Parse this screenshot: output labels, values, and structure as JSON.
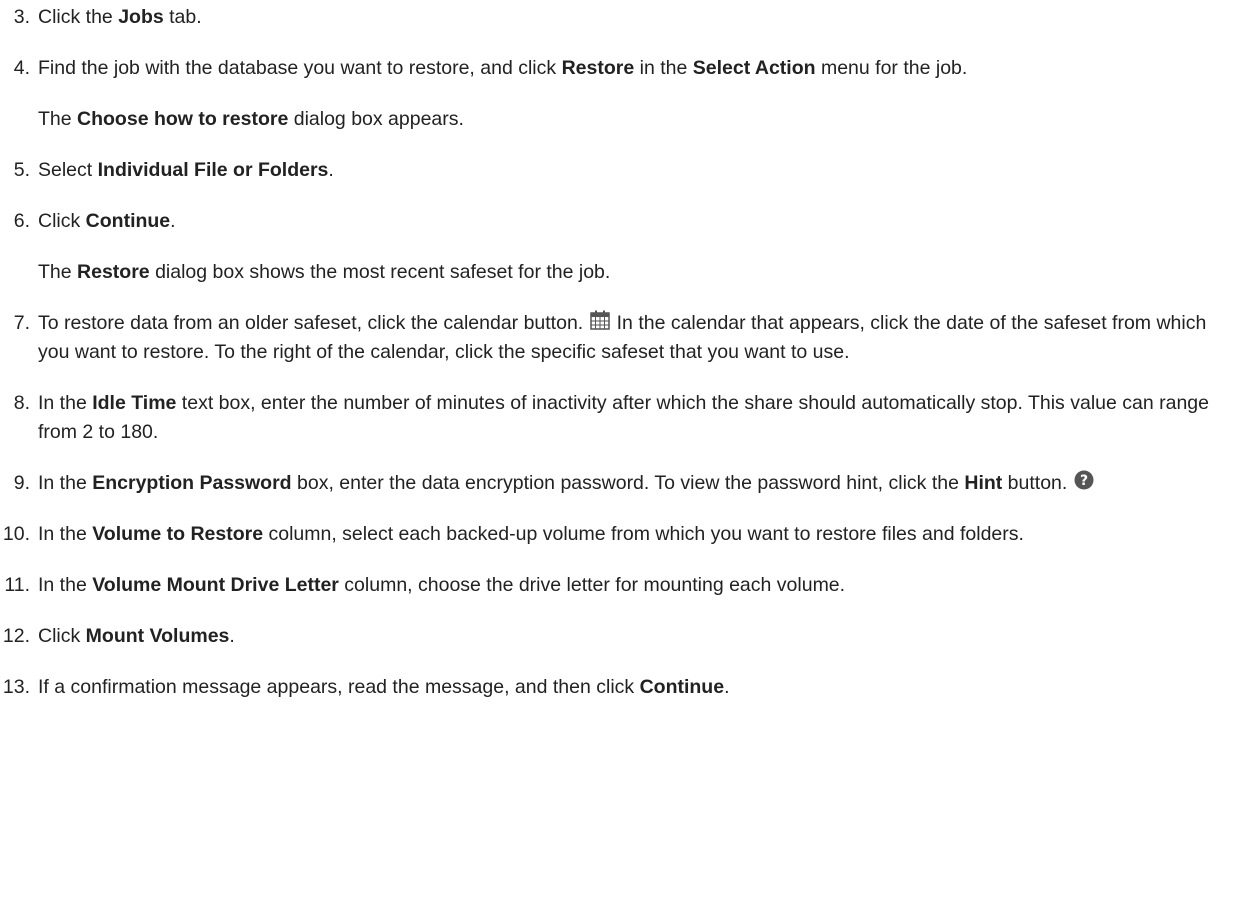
{
  "steps": {
    "s3": {
      "num": "3.",
      "t1": "Click the ",
      "b1": "Jobs",
      "t2": " tab."
    },
    "s4": {
      "num": "4.",
      "t1": "Find the job with the database you want to restore, and click ",
      "b1": "Restore",
      "t2": " in the ",
      "b2": "Select Action",
      "t3": " menu for the job."
    },
    "n4": {
      "t1": "The ",
      "b1": "Choose how to restore",
      "t2": " dialog box appears."
    },
    "s5": {
      "num": "5.",
      "t1": "Select ",
      "b1": "Individual File or Folders",
      "t2": "."
    },
    "s6": {
      "num": "6.",
      "t1": "Click ",
      "b1": "Continue",
      "t2": "."
    },
    "n6": {
      "t1": "The ",
      "b1": "Restore",
      "t2": " dialog box shows the most recent safeset for the job."
    },
    "s7": {
      "num": "7.",
      "t1": "To restore data from an older safeset, click the calendar button.",
      "t2": " In the calendar that appears, click the date of the safeset from which you want to restore. To the right of the calendar, click the specific safeset that you want to use."
    },
    "s8": {
      "num": "8.",
      "t1": "In the ",
      "b1": "Idle Time",
      "t2": " text box, enter the number of minutes of inactivity after which the share should automatically stop. This value can range from 2 to 180."
    },
    "s9": {
      "num": "9.",
      "t1": "In the ",
      "b1": "Encryption Password",
      "t2": " box, enter the data encryption password. To view the password hint, click the ",
      "b2": "Hint",
      "t3": " button."
    },
    "s10": {
      "num": "10.",
      "t1": "In the ",
      "b1": "Volume to Restore",
      "t2": " column, select each backed-up volume from which you want to restore files and folders."
    },
    "s11": {
      "num": "11.",
      "t1": "In the ",
      "b1": "Volume Mount Drive Letter",
      "t2": " column, choose the drive letter for mounting each volume."
    },
    "s12": {
      "num": "12.",
      "t1": "Click ",
      "b1": "Mount Volumes",
      "t2": "."
    },
    "s13": {
      "num": "13.",
      "t1": "If a confirmation message appears, read the message, and then click ",
      "b1": "Continue",
      "t2": "."
    }
  },
  "icons": {
    "calendar": "calendar-icon",
    "hint": "question-circle-icon"
  },
  "colors": {
    "text": "#222222",
    "calendar_icon": "#555555",
    "hint_icon": "#555555"
  }
}
